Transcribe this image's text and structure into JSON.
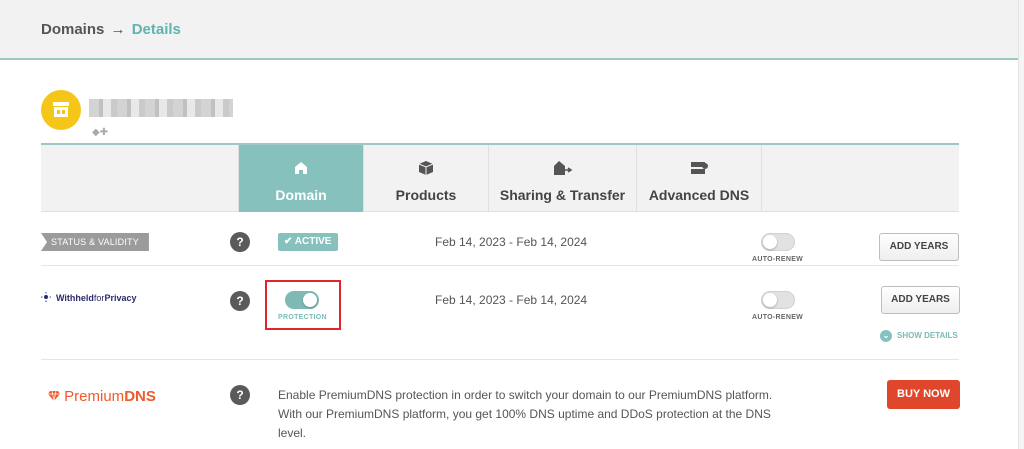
{
  "breadcrumb": {
    "parent": "Domains",
    "arrow": "→",
    "current": "Details"
  },
  "tabs": [
    {
      "label": "Domain",
      "icon": "home-icon",
      "active": true
    },
    {
      "label": "Products",
      "icon": "box-icon",
      "active": false
    },
    {
      "label": "Sharing & Transfer",
      "icon": "house-arrow-icon",
      "active": false
    },
    {
      "label": "Advanced DNS",
      "icon": "server-icon",
      "active": false
    }
  ],
  "status_row": {
    "label": "STATUS & VALIDITY",
    "help": "?",
    "badge": "✔ ACTIVE",
    "dates": "Feb 14, 2023 - Feb 14, 2024",
    "auto_renew_label": "AUTO-RENEW",
    "auto_renew": false,
    "add_years_label": "ADD YEARS"
  },
  "privacy_row": {
    "brand_bold": "Withheld",
    "brand_light": "for",
    "brand_end": "Privacy",
    "help": "?",
    "protection_label": "PROTECTION",
    "protection": true,
    "dates": "Feb 14, 2023 - Feb 14, 2024",
    "auto_renew_label": "AUTO-RENEW",
    "auto_renew": false,
    "add_years_label": "ADD YEARS",
    "show_details_label": "SHOW DETAILS"
  },
  "premium_row": {
    "brand_light": "Premium",
    "brand_bold": "DNS",
    "help": "?",
    "description": "Enable PremiumDNS protection in order to switch your domain to our PremiumDNS platform. With our PremiumDNS platform, you get 100% DNS uptime and DDoS protection at the DNS level.",
    "buy_label": "BUY NOW"
  },
  "colors": {
    "accent": "#86c1be",
    "buy": "#e0462b",
    "logo": "#f5c518",
    "highlight": "#e0262b",
    "premium": "#f05a28"
  }
}
